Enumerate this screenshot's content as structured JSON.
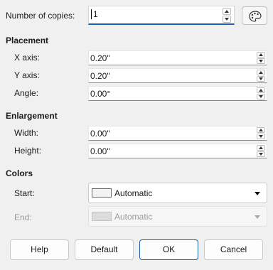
{
  "copies": {
    "label": "Number of copies:",
    "value": "1"
  },
  "placement": {
    "heading": "Placement",
    "x_label": "X axis:",
    "x_value": "0.20\"",
    "y_label": "Y axis:",
    "y_value": "0.20\"",
    "angle_label": "Angle:",
    "angle_value": "0.00°"
  },
  "enlargement": {
    "heading": "Enlargement",
    "width_label": "Width:",
    "width_value": "0.00\"",
    "height_label": "Height:",
    "height_value": "0.00\""
  },
  "colors": {
    "heading": "Colors",
    "start_label": "Start:",
    "start_value": "Automatic",
    "end_label": "End:",
    "end_value": "Automatic"
  },
  "buttons": {
    "help": "Help",
    "default": "Default",
    "ok": "OK",
    "cancel": "Cancel"
  },
  "icons": {
    "values_from_selection": "palette-icon"
  }
}
